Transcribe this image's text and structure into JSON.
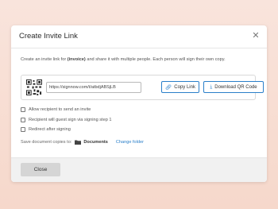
{
  "dialog": {
    "title": "Create Invite Link",
    "close_icon": "close-icon",
    "description": {
      "before": "Create an invite link for ",
      "document": "(invoice)",
      "after": " and share it with multiple people. Each person will sign their own copy."
    },
    "link": {
      "url": "https://signnow.com/t/atbdjABSjLB",
      "copy_label": "Copy Link",
      "download_label": "Download QR Code",
      "copy_icon": "link-icon",
      "download_icon": "download-icon",
      "qr_icon": "qr-code-icon"
    },
    "options": [
      {
        "label": "Allow recipient to send an invite",
        "checked": false
      },
      {
        "label": "Recipient will guest sign via signing step 1",
        "checked": false
      },
      {
        "label": "Redirect after signing",
        "checked": false
      }
    ],
    "save": {
      "label": "Save document copies to:",
      "folder": "Documents",
      "change_label": "Change folder"
    },
    "footer": {
      "close_label": "Close"
    }
  },
  "colors": {
    "accent": "#2a7fc9",
    "backdrop": "#f8ddd2"
  }
}
